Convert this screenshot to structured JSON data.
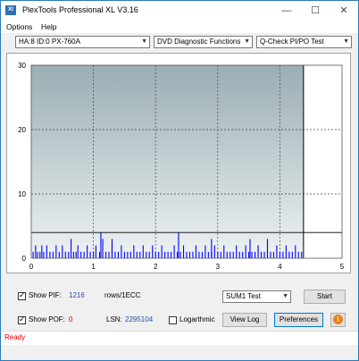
{
  "window": {
    "title": "PlexTools Professional XL V3.16",
    "icon_text": "Xt",
    "controls": {
      "minimize": "—",
      "maximize": "☐",
      "close": "✕"
    }
  },
  "menu": {
    "options": "Options",
    "help": "Help"
  },
  "toolbar": {
    "drive": "HA:8 ID:0  PX-760A",
    "function": "DVD Diagnostic Functions",
    "test": "Q-Check PI/PO Test"
  },
  "chart_data": {
    "type": "bar",
    "y_ticks": [
      "30",
      "20",
      "10",
      "0"
    ],
    "x_ticks": [
      "0",
      "1",
      "2",
      "3",
      "4",
      "5"
    ],
    "ylim": [
      0,
      30
    ],
    "xlim": [
      0,
      5
    ],
    "threshold": 4,
    "end_marker": 4.38,
    "grid": true,
    "colors": {
      "bars": "#0000ff",
      "bg_top": "#9aaeb4",
      "bg_bottom": "#eef2f2"
    },
    "values": [
      [
        0.03,
        1
      ],
      [
        0.07,
        2
      ],
      [
        0.1,
        1
      ],
      [
        0.14,
        1
      ],
      [
        0.17,
        2
      ],
      [
        0.2,
        1
      ],
      [
        0.25,
        2
      ],
      [
        0.3,
        1
      ],
      [
        0.35,
        1
      ],
      [
        0.4,
        2
      ],
      [
        0.45,
        1
      ],
      [
        0.5,
        2
      ],
      [
        0.55,
        1
      ],
      [
        0.6,
        1
      ],
      [
        0.64,
        3
      ],
      [
        0.68,
        1
      ],
      [
        0.72,
        1
      ],
      [
        0.75,
        2
      ],
      [
        0.8,
        1
      ],
      [
        0.85,
        1
      ],
      [
        0.9,
        2
      ],
      [
        0.95,
        1
      ],
      [
        1.0,
        1
      ],
      [
        1.04,
        2
      ],
      [
        1.1,
        1
      ],
      [
        1.15,
        3
      ],
      [
        1.2,
        1
      ],
      [
        1.25,
        1
      ],
      [
        1.3,
        2
      ],
      [
        1.35,
        1
      ],
      [
        1.4,
        1
      ],
      [
        1.45,
        2
      ],
      [
        1.5,
        1
      ],
      [
        1.55,
        1
      ],
      [
        1.6,
        1
      ],
      [
        1.65,
        2
      ],
      [
        1.7,
        1
      ],
      [
        1.75,
        1
      ],
      [
        1.8,
        2
      ],
      [
        1.85,
        1
      ],
      [
        1.9,
        1
      ],
      [
        1.95,
        2
      ],
      [
        2.0,
        1
      ],
      [
        2.05,
        1
      ],
      [
        2.1,
        2
      ],
      [
        2.15,
        1
      ],
      [
        2.2,
        1
      ],
      [
        2.25,
        1
      ],
      [
        2.3,
        2
      ],
      [
        2.35,
        1
      ],
      [
        2.4,
        1
      ],
      [
        2.45,
        2
      ],
      [
        2.5,
        1
      ],
      [
        2.55,
        1
      ],
      [
        2.6,
        1
      ],
      [
        2.65,
        2
      ],
      [
        2.7,
        1
      ],
      [
        2.75,
        1
      ],
      [
        2.8,
        2
      ],
      [
        2.85,
        1
      ],
      [
        2.9,
        1
      ],
      [
        2.95,
        2
      ],
      [
        3.0,
        1
      ],
      [
        3.05,
        1
      ],
      [
        3.1,
        2
      ],
      [
        3.15,
        1
      ],
      [
        3.2,
        1
      ],
      [
        3.25,
        1
      ],
      [
        3.3,
        2
      ],
      [
        3.35,
        1
      ],
      [
        3.4,
        1
      ],
      [
        3.45,
        2
      ],
      [
        3.5,
        1
      ],
      [
        3.55,
        1
      ],
      [
        3.6,
        1
      ],
      [
        3.65,
        2
      ],
      [
        3.7,
        1
      ],
      [
        3.75,
        1
      ],
      [
        3.8,
        2
      ],
      [
        3.85,
        1
      ],
      [
        3.9,
        1
      ],
      [
        3.95,
        2
      ],
      [
        4.0,
        1
      ],
      [
        4.05,
        1
      ],
      [
        4.1,
        2
      ],
      [
        4.15,
        1
      ],
      [
        4.2,
        1
      ],
      [
        4.25,
        2
      ],
      [
        4.3,
        1
      ],
      [
        4.35,
        1
      ],
      [
        1.12,
        4
      ],
      [
        2.37,
        4
      ],
      [
        3.52,
        3
      ],
      [
        1.3,
        3
      ],
      [
        2.9,
        3
      ],
      [
        3.8,
        3
      ]
    ]
  },
  "controls": {
    "show_pif_label": "Show PIF:",
    "pif_value": "1216",
    "pif_unit": "rows/1ECC",
    "show_pof_label": "Show POF:",
    "pof_value": "0",
    "lsn_label": "LSN:",
    "lsn_value": "2295104",
    "logarithmic_label": "Logarthmic",
    "sum_select": "SUM1 Test",
    "start_button": "Start",
    "view_log_button": "View Log",
    "preferences_button": "Preferences",
    "info_icon": "i"
  },
  "status": {
    "text": "Ready"
  }
}
